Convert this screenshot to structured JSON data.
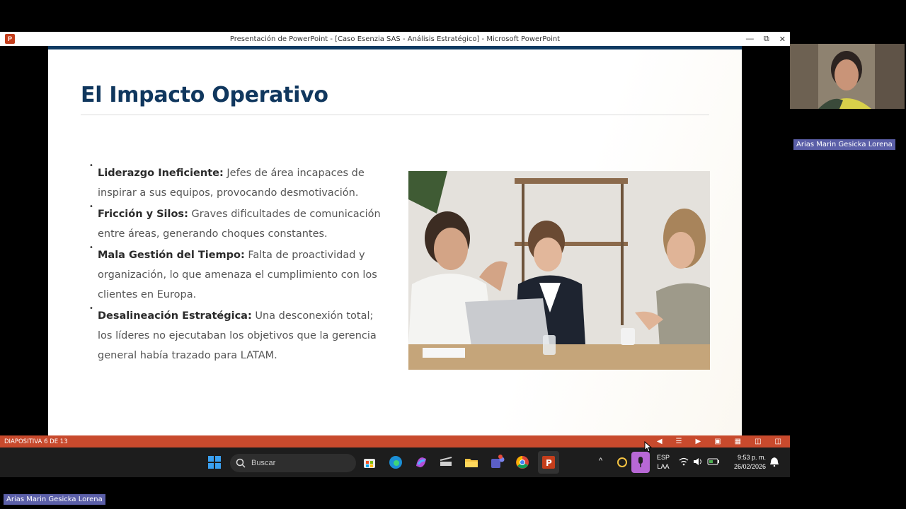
{
  "window": {
    "title": "Presentación de PowerPoint - [Caso Esenzia SAS - Análisis Estratégico] - Microsoft PowerPoint",
    "app_icon": "P"
  },
  "slide": {
    "title": "El Impacto Operativo",
    "bullets": [
      {
        "bold": "Liderazgo Ineficiente:",
        "text": " Jefes de área incapaces de inspirar a sus equipos, provocando desmotivación."
      },
      {
        "bold": "Fricción y Silos:",
        "text": " Graves dificultades de comunicación entre áreas, generando choques constantes."
      },
      {
        "bold": "Mala Gestión del Tiempo:",
        "text": " Falta de proactividad y organización, lo que amenaza el cumplimiento con los clientes en Europa."
      },
      {
        "bold": "Desalineación Estratégica:",
        "text": " Una desconexión total; los líderes no ejecutaban los objetivos que la gerencia general había trazado para LATAM."
      }
    ]
  },
  "statusbar": {
    "slide_indicator": "DIAPOSITIVA 6 DE 13"
  },
  "taskbar": {
    "search_placeholder": "Buscar",
    "lang_line1": "ESP",
    "lang_line2": "LAA",
    "time": "9:53 p. m.",
    "date": "26/02/2026"
  },
  "participant": {
    "name": "Arias Marin Gesicka Lorena"
  },
  "colors": {
    "title": "#10375e",
    "statusbar": "#c84a2d",
    "name_tag": "#5b5fa8"
  }
}
